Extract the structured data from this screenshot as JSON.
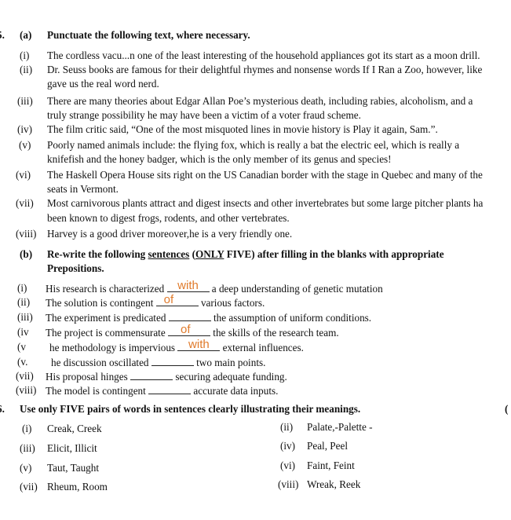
{
  "q5": {
    "number": "5.",
    "part_a": {
      "label": "(a)",
      "instruction": "Punctuate the following text, where necessary.",
      "items": [
        {
          "num": "(i)",
          "lines": [
            "The cordless vacu...n one of the least interesting of the household appliances got its start as a moon drill."
          ]
        },
        {
          "num": "(ii)",
          "lines": [
            "Dr. Seuss books are famous for their delightful rhymes and nonsense words If I Ran a Zoo, however, like",
            "gave us the real word nerd."
          ]
        },
        {
          "num": "(iii)",
          "lines": [
            "There are many theories about Edgar Allan Poe’s mysterious death, including rabies, alcoholism, and a",
            "truly strange possibility he may have been a victim of a voter fraud scheme."
          ]
        },
        {
          "num": "(iv)",
          "lines": [
            "The film critic said, “One of the most misquoted lines in movie history is Play it again, Sam.”."
          ]
        },
        {
          "num": "(v)",
          "lines": [
            "Poorly named animals include: the flying fox, which is really a bat the electric eel, which is really a",
            "knifefish and the honey badger, which is the only member of its genus and species!"
          ]
        },
        {
          "num": "(vi)",
          "lines": [
            "The Haskell Opera House sits right on the US Canadian border with the stage in Quebec and many of the",
            "seats in Vermont."
          ]
        },
        {
          "num": "(vii)",
          "lines": [
            "Most carnivorous plants attract and digest insects and other invertebrates but some large pitcher plants ha",
            "been known to digest frogs, rodents, and other vertebrates."
          ]
        },
        {
          "num": "(viii)",
          "lines": [
            "Harvey is a good driver moreover,he is a very friendly one."
          ]
        }
      ]
    },
    "part_b": {
      "label": "(b)",
      "instruction_pre": "Re-write the following ",
      "instruction_u1": "sentences",
      "instruction_mid": " (",
      "instruction_u2": "ONLY",
      "instruction_post": " FIVE) after filling in the blanks with appropriate",
      "instruction_line2": "Prepositions.",
      "items": [
        {
          "num": "(i)",
          "before": "His research is characterized",
          "answer": "with",
          "after": "a deep understanding of genetic mutation"
        },
        {
          "num": "(ii)",
          "before": "The solution is contingent",
          "answer": "of",
          "after": "various factors."
        },
        {
          "num": "(iii)",
          "before": "The experiment is predicated",
          "answer": "",
          "after": "the assumption of uniform conditions."
        },
        {
          "num": "(iv",
          "before": "The project is commensurate",
          "answer": "of",
          "after": "the skills of the research team."
        },
        {
          "num": "(v",
          "before": "he methodology is impervious",
          "answer": "with",
          "after": "external influences."
        },
        {
          "num": "(v.",
          "before": "he discussion oscillated",
          "answer": "",
          "after": "two main points."
        },
        {
          "num": "(vii)",
          "before": "His proposal hinges",
          "answer": "",
          "after": "securing adequate funding."
        },
        {
          "num": "(viii)",
          "before": "The model is contingent",
          "answer": "",
          "after": "accurate data inputs."
        }
      ]
    }
  },
  "q6": {
    "number": "6.",
    "instruction": "Use only FIVE pairs of words in sentences clearly illustrating their meanings.",
    "marks_fragment": "(",
    "pairs": [
      {
        "num": "(i)",
        "words": "Creak, Creek"
      },
      {
        "num": "(ii)",
        "words": "Palate,-Palette -"
      },
      {
        "num": "(iii)",
        "words": "Elicit, Illicit"
      },
      {
        "num": "(iv)",
        "words": "Peal, Peel"
      },
      {
        "num": "(v)",
        "words": "Taut, Taught"
      },
      {
        "num": "(vi)",
        "words": "Faint, Feint"
      },
      {
        "num": "(vii)",
        "words": "Rheum, Room"
      },
      {
        "num": "(viii)",
        "words": "Wreak, Reek"
      }
    ]
  },
  "colors": {
    "answer": "#e07b2c",
    "text": "#111111"
  }
}
